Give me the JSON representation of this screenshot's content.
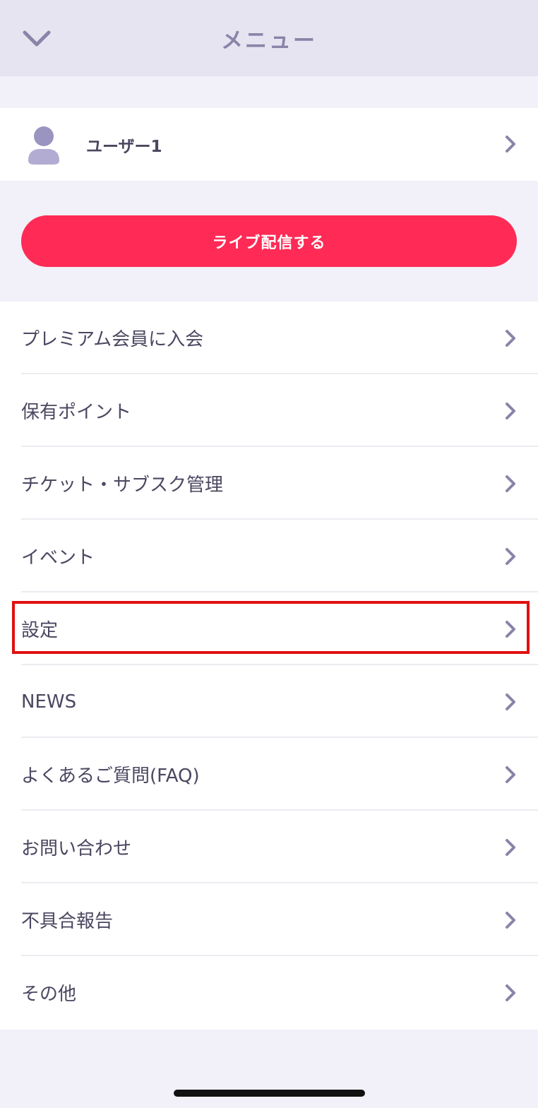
{
  "header": {
    "title": "メニュー",
    "back_icon": "chevron-down-icon"
  },
  "user": {
    "name": "ユーザー1",
    "avatar_icon": "user-avatar-icon"
  },
  "live_button": {
    "label": "ライブ配信する",
    "color": "#ff2a55"
  },
  "menu": {
    "items": [
      {
        "label": "プレミアム会員に入会"
      },
      {
        "label": "保有ポイント"
      },
      {
        "label": "チケット・サブスク管理"
      },
      {
        "label": "イベント"
      },
      {
        "label": "設定"
      },
      {
        "label": "NEWS"
      },
      {
        "label": "よくあるご質問(FAQ)"
      },
      {
        "label": "お問い合わせ"
      },
      {
        "label": "不具合報告"
      },
      {
        "label": "その他"
      }
    ],
    "highlighted_index": 4,
    "highlight_color": "#e01010"
  },
  "colors": {
    "accent_text": "#8a84a8",
    "chevron": "#8a84a8"
  }
}
